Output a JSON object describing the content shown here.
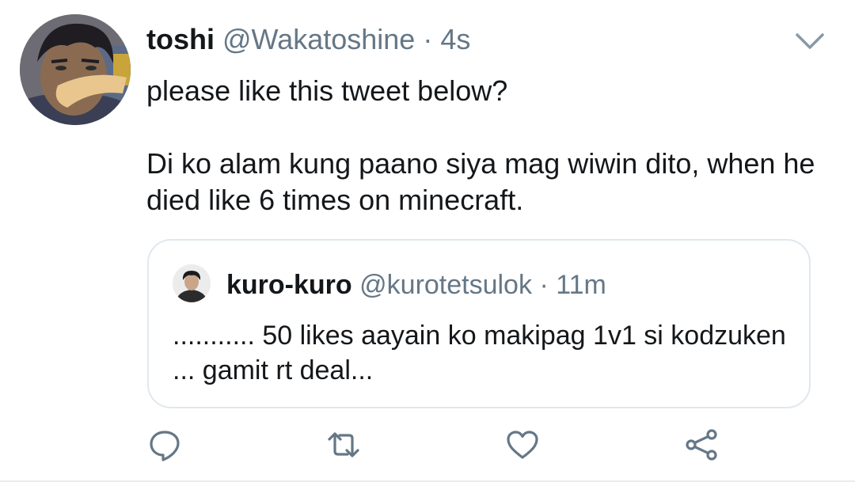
{
  "tweet": {
    "display_name": "toshi",
    "handle": "@Wakatoshine",
    "separator": "·",
    "time": "4s",
    "text_line1": "please like this tweet below?",
    "text_line2": "Di ko alam kung paano siya mag wiwin dito, when he died like 6 times on minecraft."
  },
  "quoted": {
    "display_name": "kuro-kuro",
    "handle": "@kurotetsulok",
    "separator": "·",
    "time": "11m",
    "text": "........... 50 likes aayain ko makipag 1v1 si kodzuken ... gamit rt deal..."
  },
  "icons": {
    "menu": "chevron-down-icon",
    "reply": "reply-icon",
    "retweet": "retweet-icon",
    "like": "heart-icon",
    "share": "share-icon"
  },
  "colors": {
    "text": "#14171a",
    "secondary": "#657786",
    "icon": "#657786",
    "border": "#e1e8ed"
  }
}
